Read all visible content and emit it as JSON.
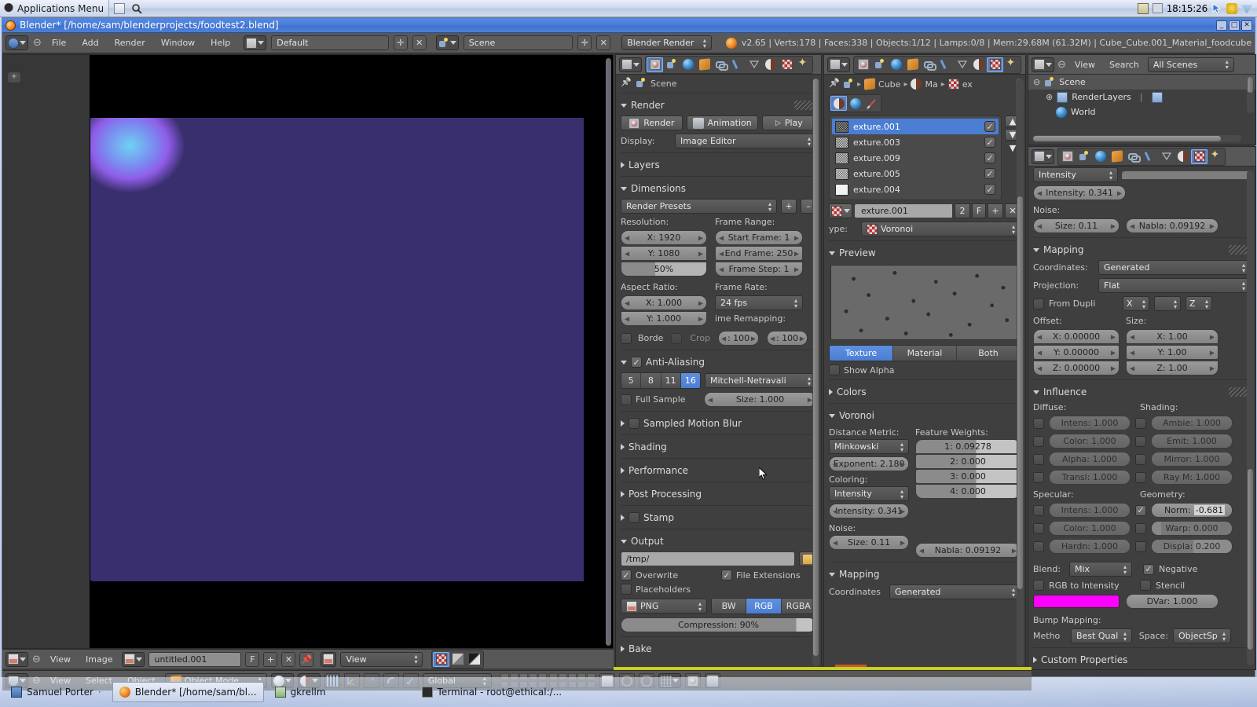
{
  "desktop": {
    "applications_menu": "Applications Menu",
    "clock": "18:15:26"
  },
  "window": {
    "title": "Blender* [/home/sam/blenderprojects/foodtest2.blend]",
    "minimize": "_",
    "maximize": "□",
    "close": "✕"
  },
  "info_header": {
    "menus": [
      "File",
      "Add",
      "Render",
      "Window",
      "Help"
    ],
    "screen_layout": "Default",
    "scene": "Scene",
    "engine": "Blender Render",
    "stats": "v2.65 | Verts:178 | Faces:338 | Objects:1/12 | Lamps:0/8 | Mem:29.68M (61.32M) | Cube_Cube.001_Material_foodcube"
  },
  "render_props": {
    "breadcrumb_scene": "Scene",
    "render_panel": {
      "title": "Render",
      "render_button": "Render",
      "animation_button": "Animation",
      "play_button": "Play",
      "display_label": "Display:",
      "display_value": "Image Editor"
    },
    "layers_panel": "Layers",
    "dimensions_panel": {
      "title": "Dimensions",
      "presets": "Render Presets",
      "add_preset": "+",
      "remove_preset": "–",
      "resolution_label": "Resolution:",
      "res_x": "X: 1920",
      "res_y": "Y: 1080",
      "res_percent": "50%",
      "frame_range_label": "Frame Range:",
      "start_frame": "Start Frame: 1",
      "end_frame": "End Frame: 250",
      "frame_step": "Frame Step: 1",
      "aspect_label": "Aspect Ratio:",
      "aspect_x": "X: 1.000",
      "aspect_y": "Y: 1.000",
      "frame_rate_label": "Frame Rate:",
      "frame_rate": "24 fps",
      "time_remapping_label": "ime Remapping:",
      "remap_old": ": 100",
      "remap_new": ": 100",
      "border": "Borde",
      "crop": "Crop"
    },
    "aa_panel": {
      "title": "Anti-Aliasing",
      "samples": [
        "5",
        "8",
        "11",
        "16"
      ],
      "samples_active": "16",
      "filter": "Mitchell-Netravali",
      "full_sample": "Full Sample",
      "size": "Size: 1.000"
    },
    "collapsed_panels": [
      "Sampled Motion Blur",
      "Shading",
      "Performance",
      "Post Processing",
      "Stamp"
    ],
    "output_panel": {
      "title": "Output",
      "path": "/tmp/",
      "overwrite": "Overwrite",
      "file_extensions": "File Extensions",
      "placeholders": "Placeholders",
      "format": "PNG",
      "channels": [
        "BW",
        "RGB",
        "RGBA"
      ],
      "channels_active": "RGB",
      "compression": "Compression: 90%"
    },
    "bake_panel": "Bake"
  },
  "texture_props": {
    "breadcrumb": [
      "Cube",
      "Ma",
      "ex"
    ],
    "context_tabs": [
      "material-texture",
      "world-texture",
      "brush-texture"
    ],
    "texture_list": [
      {
        "name": "exture.001",
        "enabled": true,
        "selected": true
      },
      {
        "name": "exture.003",
        "enabled": true,
        "selected": false
      },
      {
        "name": "exture.009",
        "enabled": true,
        "selected": false
      },
      {
        "name": "exture.005",
        "enabled": true,
        "selected": false
      },
      {
        "name": "exture.004",
        "enabled": true,
        "selected": false
      }
    ],
    "datablock_name": "exture.001",
    "users": "2",
    "fake_user": "F",
    "new_button": "+",
    "unlink_button": "✕",
    "type_label": "ype:",
    "type_value": "Voronoi",
    "preview_panel": "Preview",
    "preview_tabs": [
      "Texture",
      "Material",
      "Both"
    ],
    "preview_tab_active": "Texture",
    "show_alpha": "Show Alpha",
    "colors_panel": "Colors",
    "voronoi_panel": {
      "title": "Voronoi",
      "distance_metric_label": "Distance Metric:",
      "distance_metric": "Minkowski",
      "exponent": "Exponent: 2.180",
      "coloring_label": "Coloring:",
      "coloring": "Intensity",
      "intensity": "Intensity: 0.341",
      "noise_label": "Noise:",
      "noise_size": "Size: 0.11",
      "nabla": "Nabla: 0.09192",
      "feature_weights_label": "Feature Weights:",
      "weights": [
        "1: 0.09278",
        "2: 0.000",
        "3: 0.000",
        "4: 0.000"
      ]
    },
    "mapping_panel": {
      "title": "Mapping",
      "coordinates_label": "Coordinates",
      "coordinates": "Generated"
    }
  },
  "outliner": {
    "display_mode": "outliner-icon",
    "view_menu": "View",
    "search_menu": "Search",
    "scope": "All Scenes",
    "tree": [
      {
        "label": "Scene",
        "depth": 0,
        "expander": "−"
      },
      {
        "label": "RenderLayers",
        "depth": 1,
        "expander": "+"
      },
      {
        "label": "World",
        "depth": 1,
        "expander": ""
      }
    ]
  },
  "texture_props_right": {
    "coloring": "Intensity",
    "intensity": "Intensity: 0.341",
    "noise_label": "Noise:",
    "noise_size": "Size: 0.11",
    "nabla": "Nabla: 0.09192",
    "mapping": {
      "title": "Mapping",
      "coordinates_label": "Coordinates:",
      "coordinates": "Generated",
      "projection_label": "Projection:",
      "projection": "Flat",
      "from_dupli": "From Dupli",
      "axis_x": "X",
      "axis_y": "",
      "axis_z": "Z",
      "offset_label": "Offset:",
      "offset_x": "X: 0.00000",
      "offset_y": "Y: 0.00000",
      "offset_z": "Z: 0.00000",
      "size_label": "Size:",
      "size_x": "X: 1.00",
      "size_y": "Y: 1.00",
      "size_z": "Z: 1.00"
    },
    "influence": {
      "title": "Influence",
      "diffuse_label": "Diffuse:",
      "diffuse": [
        {
          "label": "Intens: 1.000",
          "on": false
        },
        {
          "label": "Color: 1.000",
          "on": false
        },
        {
          "label": "Alpha: 1.000",
          "on": false
        },
        {
          "label": "Transl: 1.000",
          "on": false
        }
      ],
      "shading_label": "Shading:",
      "shading": [
        {
          "label": "Ambie: 1.000",
          "on": false
        },
        {
          "label": "Emit: 1.000",
          "on": false
        },
        {
          "label": "Mirror: 1.000",
          "on": false
        },
        {
          "label": "Ray M: 1.000",
          "on": false
        }
      ],
      "specular_label": "Specular:",
      "specular": [
        {
          "label": "Intens: 1.000",
          "on": false
        },
        {
          "label": "Color: 1.000",
          "on": false
        },
        {
          "label": "Hardn: 1.000",
          "on": false
        }
      ],
      "geometry_label": "Geometry:",
      "geometry": [
        {
          "label": "Norm:",
          "value": "-0.681",
          "on": true
        },
        {
          "label": "Warp: 0.000",
          "on": false
        },
        {
          "label": "Displa: 0.200",
          "on": false
        }
      ],
      "blend_label": "Blend:",
      "blend": "Mix",
      "negative": "Negative",
      "rgb_to_intensity": "RGB to Intensity",
      "stencil": "Stencil",
      "color_swatch": "#FF00FF",
      "dvar": "DVar: 1.000",
      "bump_mapping_label": "Bump Mapping:",
      "method_label": "Metho",
      "method": "Best Qual",
      "space_label": "Space:",
      "space": "ObjectSp"
    },
    "custom_properties": "Custom Properties"
  },
  "image_editor": {
    "view_menu": "View",
    "image_menu": "Image",
    "datablock": "untitled.001",
    "fake_user": "F",
    "new_button": "+",
    "unlink_button": "✕",
    "view_mode": "View",
    "display_channels": [
      "color-and-alpha",
      "alpha",
      "z-buffer"
    ]
  },
  "view3d_header": {
    "view_menu": "View",
    "select_menu": "Select",
    "object_menu": "Object",
    "mode": "Object Mode",
    "transform_orientation": "Global"
  },
  "taskbar": {
    "items": [
      {
        "label": "Samuel Porter",
        "icon": "blue",
        "active": false
      },
      {
        "label": "Blender* [/home/sam/bl...",
        "icon": "blend",
        "active": true
      },
      {
        "label": "gkrellm",
        "icon": "gk",
        "active": false
      },
      {
        "label": "Terminal - root@ethical:/...",
        "icon": "term",
        "active": false
      }
    ]
  },
  "colors": {
    "accent_blue": "#4b7ed2",
    "magenta": "#FF00FF",
    "header_gray": "#585858",
    "panel_gray": "#3f3f3f"
  }
}
